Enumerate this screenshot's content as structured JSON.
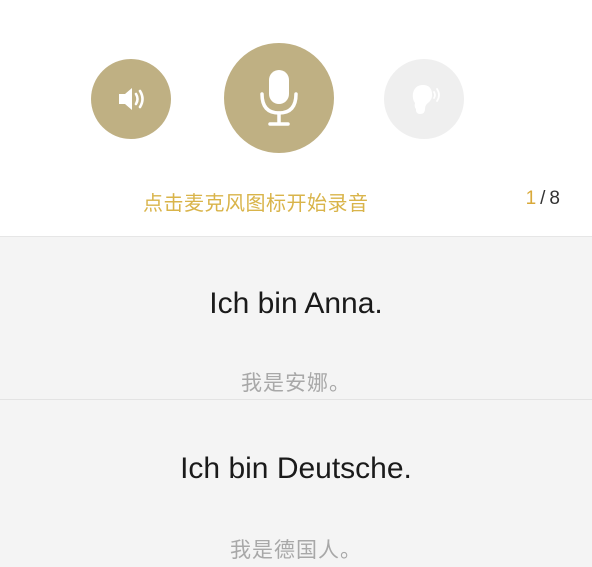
{
  "controls": {
    "speaker_icon": "speaker-volume-icon",
    "mic_icon": "microphone-icon",
    "ear_icon": "ear-listen-icon",
    "accent_color": "#bfb083",
    "disabled_color": "#efefef"
  },
  "hint": {
    "text": "点击麦克风图标开始录音",
    "color": "#d9b44a"
  },
  "progress": {
    "current": "1",
    "separator": "/",
    "total": "8"
  },
  "sentences": [
    {
      "german": "Ich bin Anna.",
      "chinese": "我是安娜。"
    },
    {
      "german": "Ich bin Deutsche.",
      "chinese": "我是德国人。"
    }
  ]
}
